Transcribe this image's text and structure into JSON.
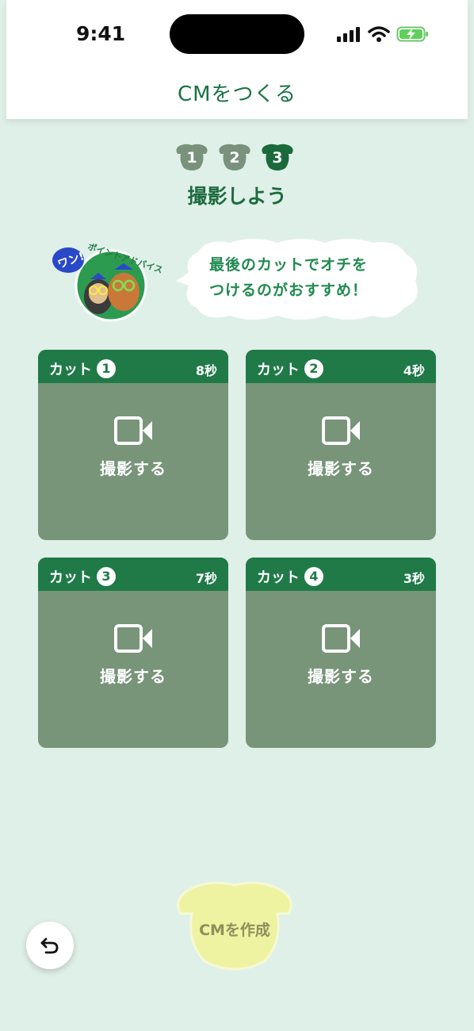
{
  "status_bar": {
    "time": "9:41"
  },
  "header": {
    "title": "CMをつくる"
  },
  "steps": [
    {
      "number": "1",
      "state": "done"
    },
    {
      "number": "2",
      "state": "done"
    },
    {
      "number": "3",
      "state": "current"
    }
  ],
  "step_subtitle": "撮影しよう",
  "advice": {
    "badge_one": "ワン!",
    "badge_two": "ポイントアドバイス",
    "line1": "最後のカットでオチを",
    "line2": "つけるのがおすすめ！"
  },
  "cuts": [
    {
      "label": "カット",
      "number": "1",
      "duration": "8秒",
      "action": "撮影する"
    },
    {
      "label": "カット",
      "number": "2",
      "duration": "4秒",
      "action": "撮影する"
    },
    {
      "label": "カット",
      "number": "3",
      "duration": "7秒",
      "action": "撮影する"
    },
    {
      "label": "カット",
      "number": "4",
      "duration": "3秒",
      "action": "撮影する"
    }
  ],
  "create_button": {
    "label": "CMを作成",
    "enabled": false
  },
  "icons": {
    "camera": "video-camera-icon",
    "back": "undo-arrow-icon",
    "step_shape": "dog-head-icon"
  },
  "colors": {
    "background": "#dff0e8",
    "primary_green": "#1f7a47",
    "card_body": "#789479",
    "step_done": "#7a927c",
    "create_button_disabled": "#eef3a2"
  }
}
